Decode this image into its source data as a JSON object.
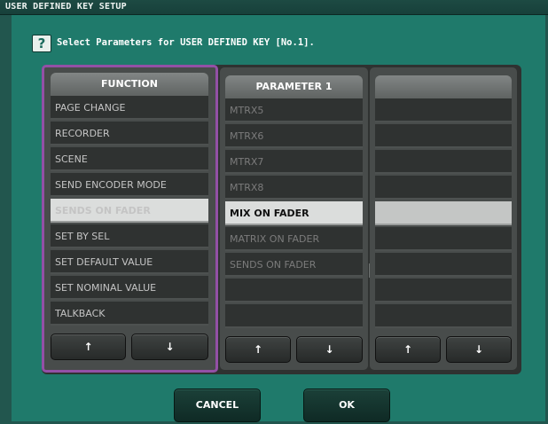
{
  "window": {
    "title": "USER DEFINED KEY SETUP"
  },
  "instruction": {
    "help_icon": "question-mark-icon",
    "text": "Select Parameters for USER DEFINED KEY [No.1]."
  },
  "columns": [
    {
      "header": "FUNCTION",
      "rows": [
        "PAGE CHANGE",
        "RECORDER",
        "SCENE",
        "SEND ENCODER MODE",
        "SENDS ON FADER",
        "SET BY SEL",
        "SET DEFAULT VALUE",
        "SET NOMINAL VALUE",
        "TALKBACK"
      ],
      "selected_index": 4
    },
    {
      "header": "PARAMETER 1",
      "rows": [
        "MTRX5",
        "MTRX6",
        "MTRX7",
        "MTRX8",
        "MIX ON FADER",
        "MATRIX ON FADER",
        "SENDS ON FADER",
        "",
        ""
      ],
      "selected_index": 4
    },
    {
      "header": "",
      "rows": [
        "",
        "",
        "",
        "",
        "",
        "",
        "",
        "",
        ""
      ],
      "selected_index": 4
    }
  ],
  "arrows": {
    "up": "↑",
    "down": "↓"
  },
  "buttons": {
    "cancel": "CANCEL",
    "ok": "OK"
  },
  "colors": {
    "panel": "#1f7a6b",
    "active_column_border": "#9350a6",
    "selected_row": "#dbdddc"
  }
}
